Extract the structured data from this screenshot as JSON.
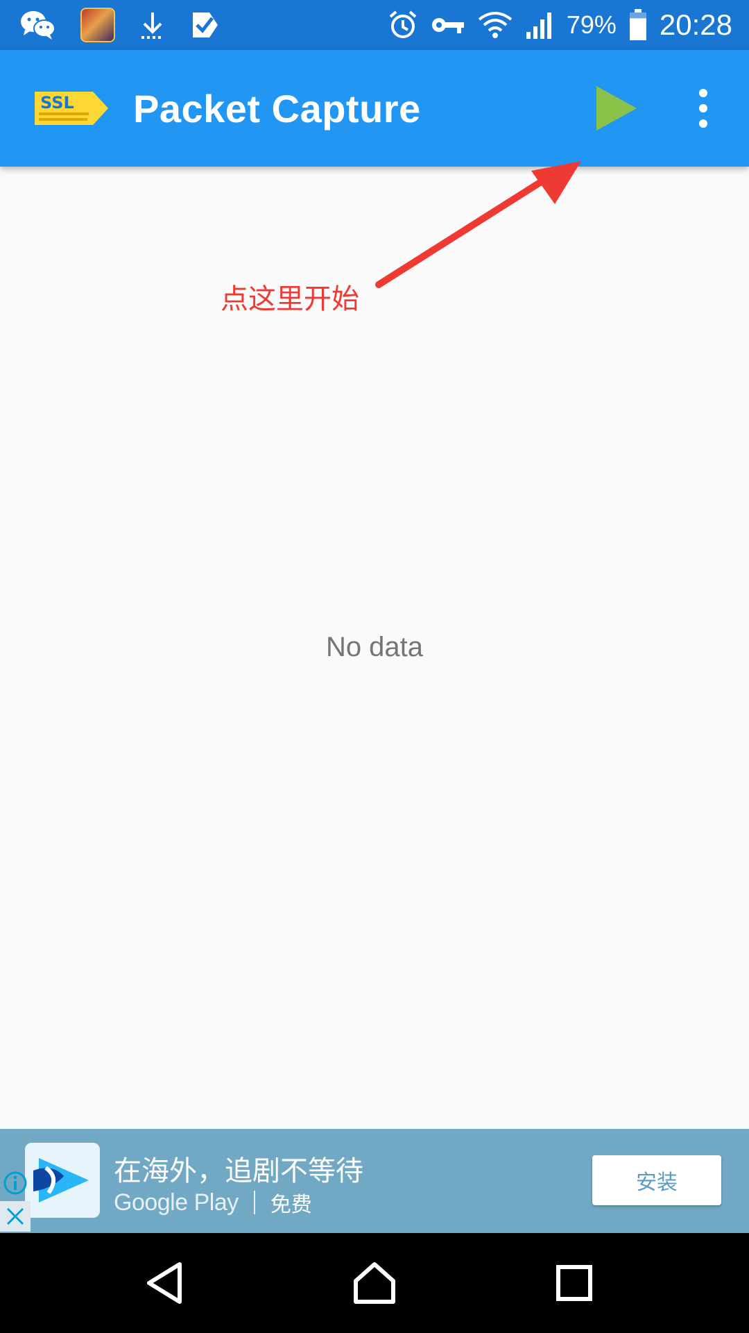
{
  "status_bar": {
    "icons_left": [
      "wechat-icon",
      "game-app-icon",
      "download-icon",
      "check-icon"
    ],
    "icons_right": [
      "alarm-icon",
      "vpn-key-icon",
      "wifi-icon",
      "signal-icon",
      "battery-icon"
    ],
    "battery_percent": "79%",
    "battery_level": 0.79,
    "time": "20:28"
  },
  "app_bar": {
    "title": "Packet Capture",
    "logo_icon": "ssl-logo-icon",
    "start_icon": "play-icon",
    "more_icon": "more-vert-icon",
    "colors": {
      "primary": "#2196f3",
      "status": "#1976d2",
      "play": "#8bc34a"
    }
  },
  "annotation": {
    "label": "点这里开始",
    "color": "#ef3a34"
  },
  "main": {
    "empty_text": "No data"
  },
  "ad": {
    "title": "在海外，追剧不等待",
    "store": "Google Play",
    "price": "免费",
    "install_label": "安装",
    "info_icon": "info-icon",
    "close_icon": "close-icon"
  },
  "nav_bar": {
    "buttons": [
      "back-icon",
      "home-icon",
      "recents-icon"
    ]
  }
}
